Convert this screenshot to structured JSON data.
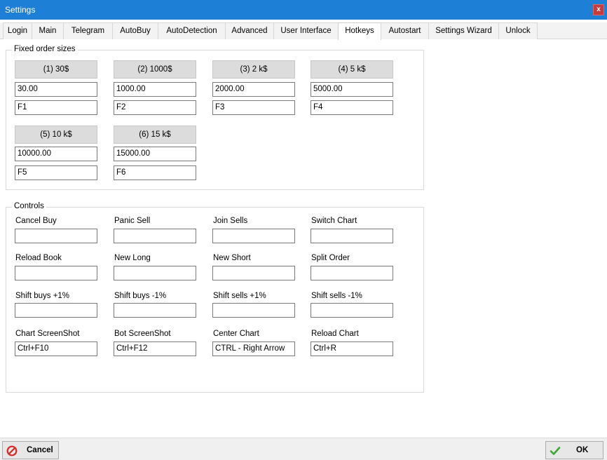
{
  "window": {
    "title": "Settings",
    "close_label": "x"
  },
  "tabs": [
    {
      "label": "Login"
    },
    {
      "label": "Main"
    },
    {
      "label": "Telegram"
    },
    {
      "label": "AutoBuy"
    },
    {
      "label": "AutoDetection"
    },
    {
      "label": "Advanced"
    },
    {
      "label": "User Interface"
    },
    {
      "label": "Hotkeys",
      "active": true
    },
    {
      "label": "Autostart"
    },
    {
      "label": "Settings Wizard"
    },
    {
      "label": "Unlock"
    }
  ],
  "fixed_order_sizes": {
    "legend": "Fixed order sizes",
    "items": [
      {
        "button": "(1)  30$",
        "amount": "30.00",
        "hotkey": "F1"
      },
      {
        "button": "(2)  1000$",
        "amount": "1000.00",
        "hotkey": "F2"
      },
      {
        "button": "(3)  2 k$",
        "amount": "2000.00",
        "hotkey": "F3"
      },
      {
        "button": "(4)  5 k$",
        "amount": "5000.00",
        "hotkey": "F4"
      },
      {
        "button": "(5)  10 k$",
        "amount": "10000.00",
        "hotkey": "F5"
      },
      {
        "button": "(6)  15 k$",
        "amount": "15000.00",
        "hotkey": "F6"
      }
    ]
  },
  "controls": {
    "legend": "Controls",
    "items": [
      {
        "label": "Cancel Buy",
        "value": ""
      },
      {
        "label": "Panic Sell",
        "value": ""
      },
      {
        "label": "Join Sells",
        "value": ""
      },
      {
        "label": "Switch Chart",
        "value": ""
      },
      {
        "label": "Reload Book",
        "value": ""
      },
      {
        "label": "New Long",
        "value": ""
      },
      {
        "label": "New Short",
        "value": ""
      },
      {
        "label": "Split Order",
        "value": ""
      },
      {
        "label": "Shift buys +1%",
        "value": ""
      },
      {
        "label": "Shift buys -1%",
        "value": ""
      },
      {
        "label": "Shift sells +1%",
        "value": ""
      },
      {
        "label": "Shift sells -1%",
        "value": ""
      },
      {
        "label": "Chart ScreenShot",
        "value": "Ctrl+F10"
      },
      {
        "label": "Bot ScreenShot",
        "value": "Ctrl+F12"
      },
      {
        "label": "Center Chart",
        "value": "CTRL - Right Arrow"
      },
      {
        "label": "Reload Chart",
        "value": "Ctrl+R"
      }
    ]
  },
  "footer": {
    "cancel": {
      "label": "Cancel",
      "icon": "cancel-icon",
      "color": "#d42a2a"
    },
    "ok": {
      "label": "OK",
      "icon": "checkmark-icon",
      "color": "#3aa832"
    }
  }
}
